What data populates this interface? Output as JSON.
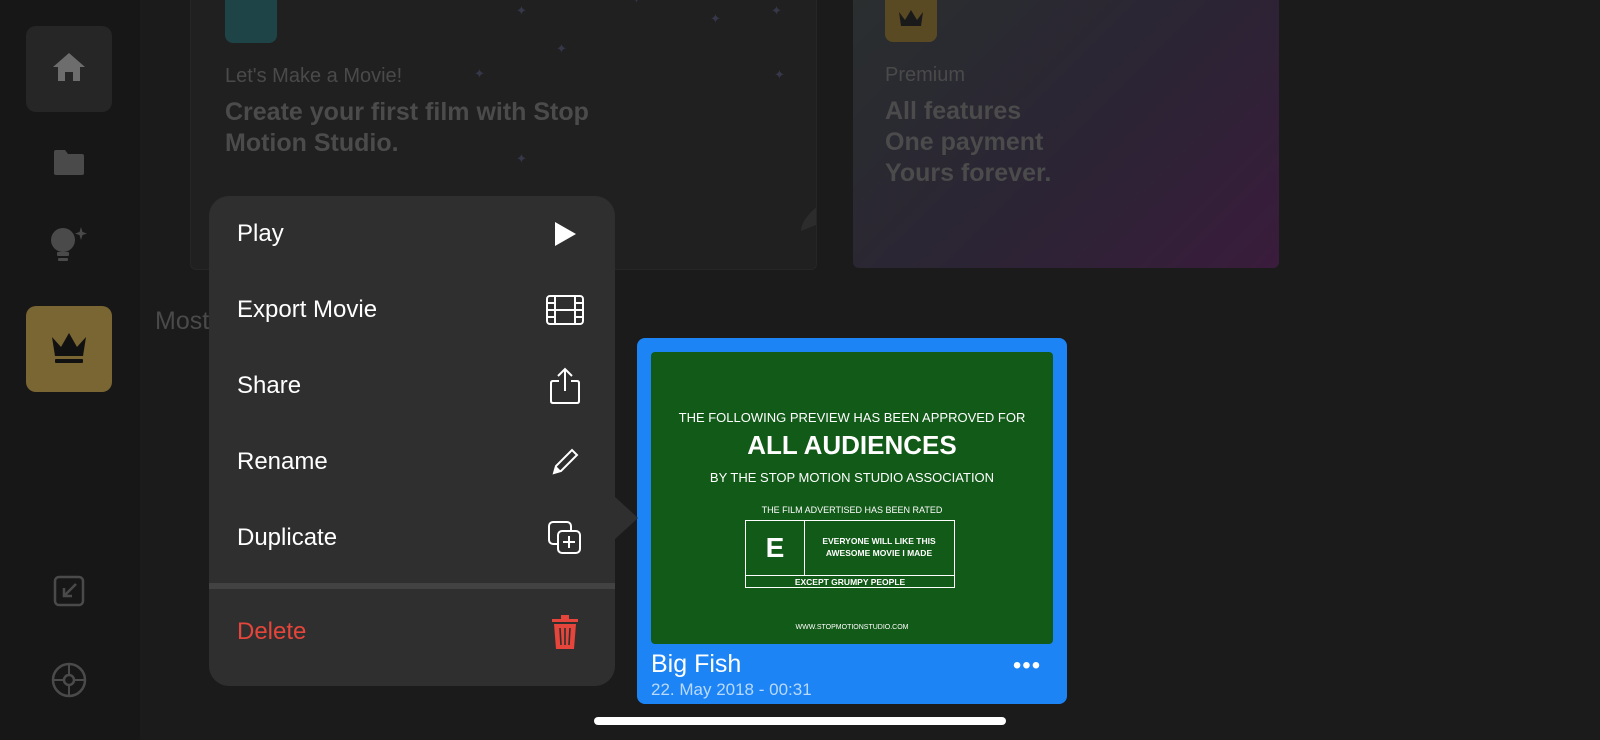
{
  "sidebar": {
    "items": [
      {
        "icon": "home-icon"
      },
      {
        "icon": "folder-icon"
      },
      {
        "icon": "lightbulb-sparkle-icon"
      },
      {
        "icon": "crown-icon"
      },
      {
        "icon": "import-icon"
      },
      {
        "icon": "settings-icon"
      }
    ]
  },
  "cards": {
    "movie": {
      "kicker": "Let's Make a Movie!",
      "title": "Create your first film with Stop Motion Studio.",
      "icon": "movie-camera-icon"
    },
    "premium": {
      "kicker": "Premium",
      "title_lines": [
        "All features",
        "One payment",
        "Yours forever."
      ],
      "icon": "crown-icon"
    }
  },
  "section": {
    "label": "Most"
  },
  "menu": {
    "items": [
      {
        "label": "Play",
        "icon": "play-icon"
      },
      {
        "label": "Export Movie",
        "icon": "film-icon"
      },
      {
        "label": "Share",
        "icon": "share-icon"
      },
      {
        "label": "Rename",
        "icon": "pencil-icon"
      },
      {
        "label": "Duplicate",
        "icon": "duplicate-icon"
      },
      {
        "label": "Delete",
        "icon": "trash-icon"
      }
    ]
  },
  "project": {
    "title": "Big Fish",
    "date": "22. May 2018 - 00:31",
    "more": "•••",
    "thumbnail": {
      "line1": "THE FOLLOWING PREVIEW HAS BEEN APPROVED FOR",
      "line2": "ALL AUDIENCES",
      "line3": "BY THE STOP MOTION STUDIO ASSOCIATION",
      "line4": "THE FILM ADVERTISED HAS BEEN RATED",
      "rating": "E",
      "rating_desc": "EVERYONE WILL LIKE THIS AWESOME MOVIE I MADE",
      "rating_foot": "EXCEPT GRUMPY PEOPLE",
      "url": "WWW.STOPMOTIONSTUDIO.COM"
    }
  },
  "colors": {
    "accent": "#1c84f5",
    "delete": "#e5453a",
    "menu_bg": "#2f2f2f",
    "premium": "#7a6632"
  }
}
